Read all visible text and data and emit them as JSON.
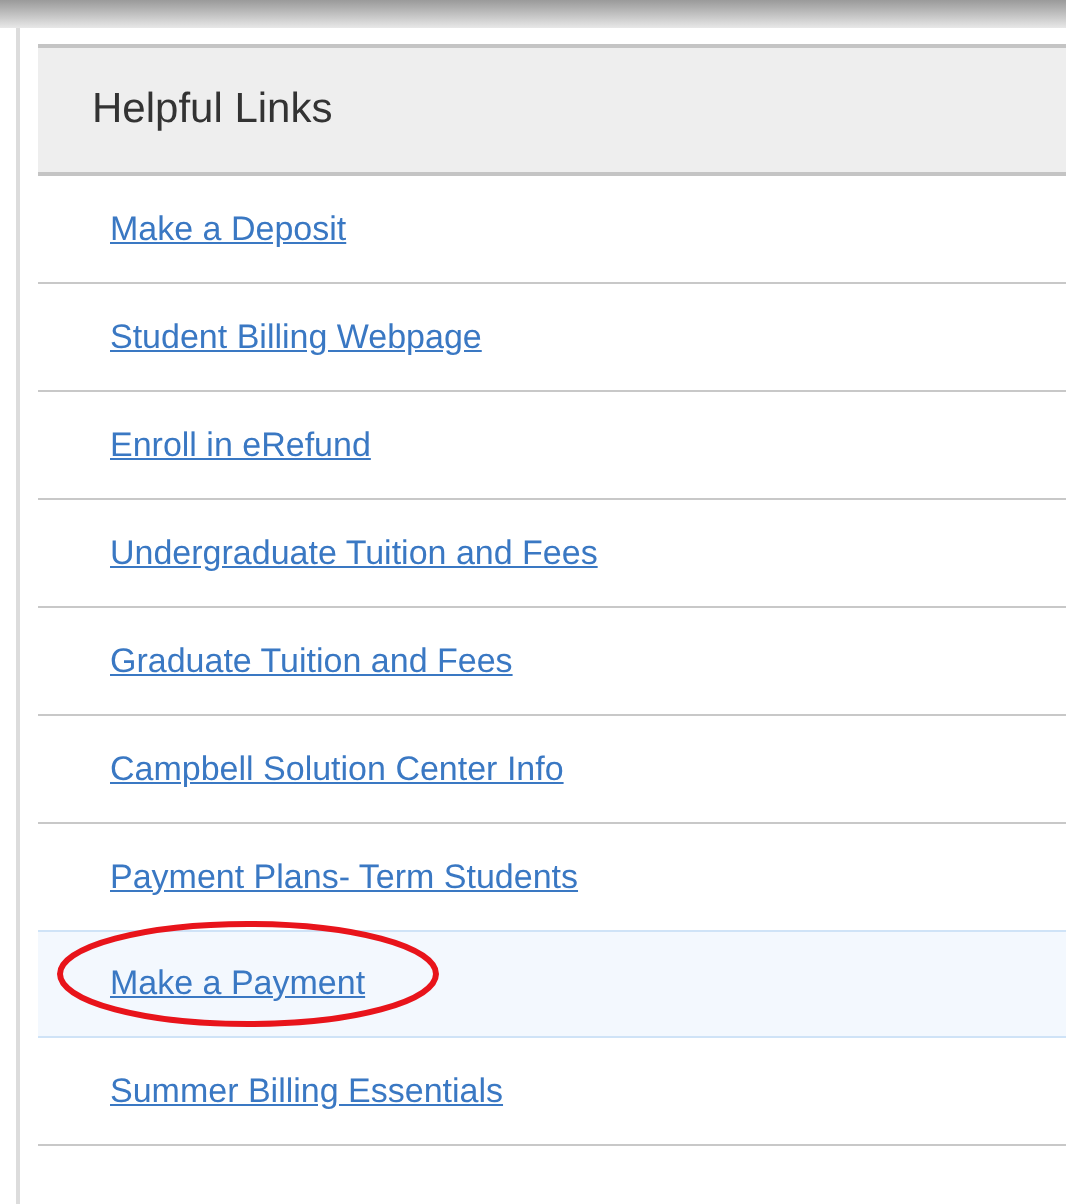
{
  "panel": {
    "title": "Helpful Links",
    "links": [
      {
        "label": "Make a Deposit",
        "highlighted": false,
        "circled": false
      },
      {
        "label": "Student Billing Webpage",
        "highlighted": false,
        "circled": false
      },
      {
        "label": "Enroll in eRefund",
        "highlighted": false,
        "circled": false
      },
      {
        "label": "Undergraduate Tuition and Fees",
        "highlighted": false,
        "circled": false
      },
      {
        "label": "Graduate Tuition and Fees",
        "highlighted": false,
        "circled": false
      },
      {
        "label": "Campbell Solution Center Info",
        "highlighted": false,
        "circled": false
      },
      {
        "label": "Payment Plans- Term Students",
        "highlighted": false,
        "circled": false
      },
      {
        "label": "Make a Payment",
        "highlighted": true,
        "circled": true
      },
      {
        "label": "Summer Billing Essentials",
        "highlighted": false,
        "circled": false
      }
    ]
  }
}
